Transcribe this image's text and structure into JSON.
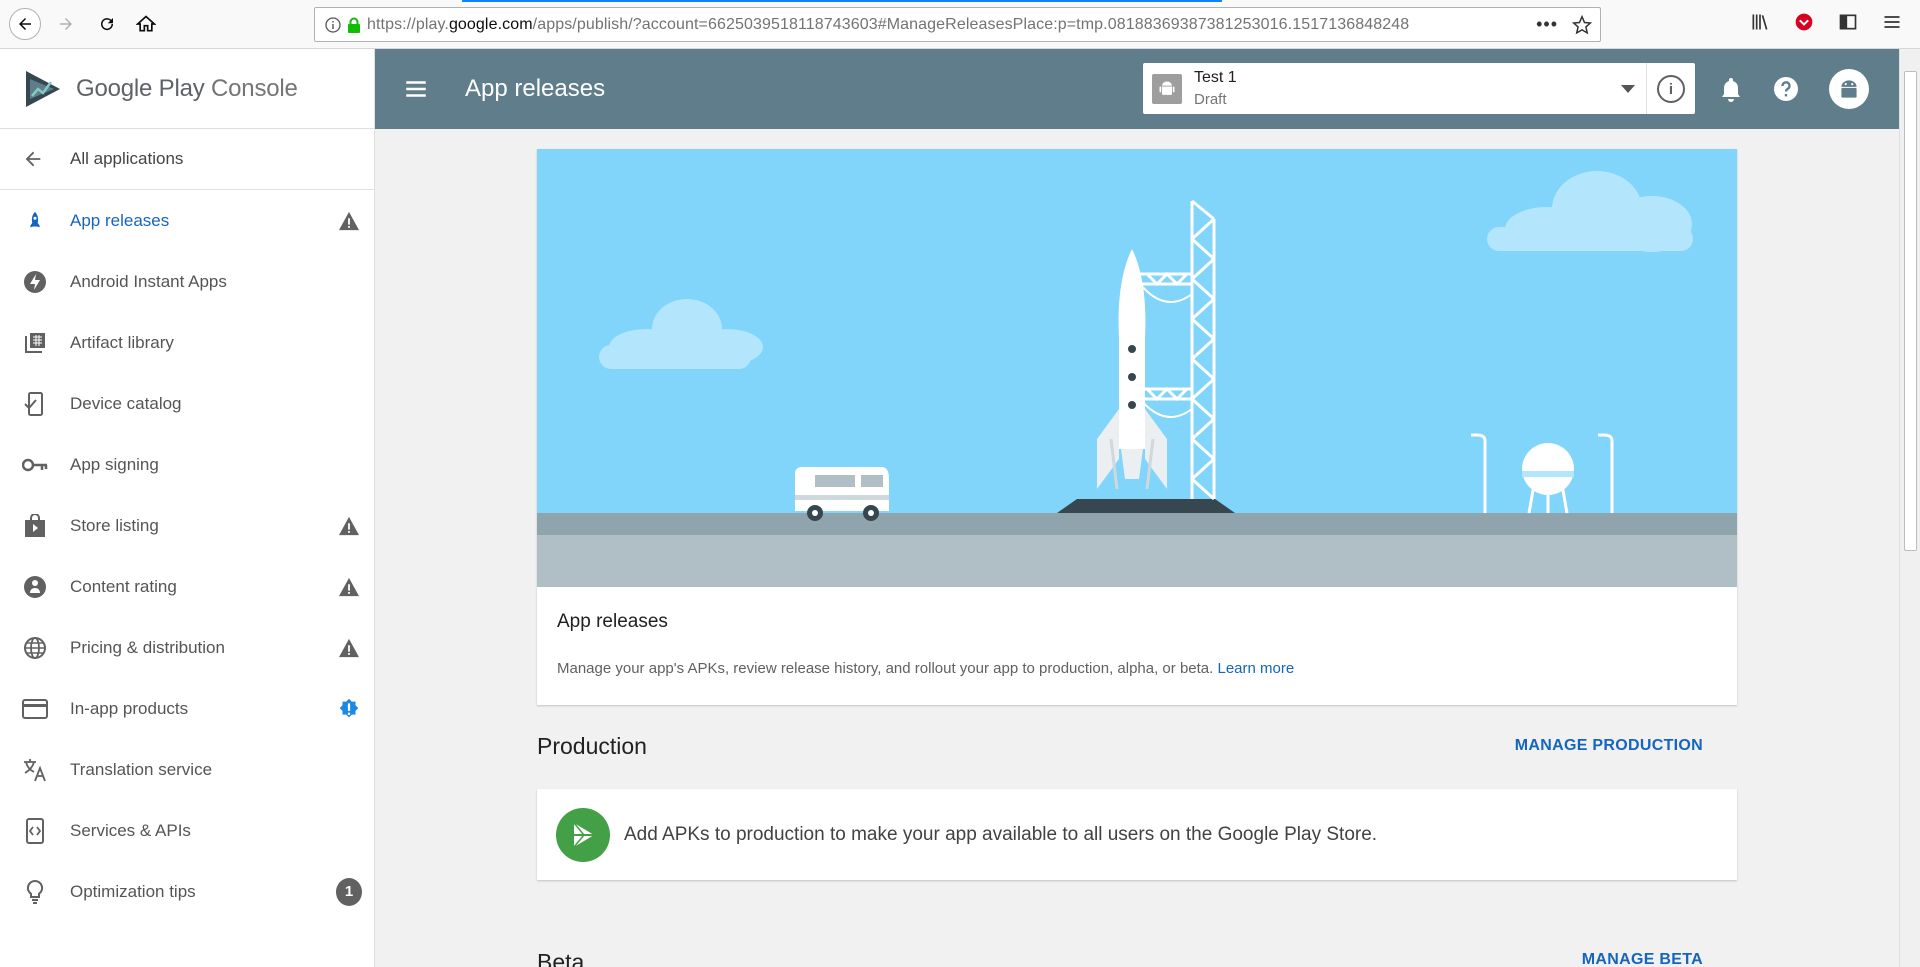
{
  "browser": {
    "url_prefix": "https://play.",
    "url_domain": "google.com",
    "url_rest": "/apps/publish/?account=6625039518118743603#ManageReleasesPlace:p=tmp.08188369387381253016.1517136848248"
  },
  "sidebar": {
    "brand_google_play": "Google Play",
    "brand_console": "Console",
    "back_label": "All applications",
    "items": [
      {
        "label": "App releases",
        "icon": "rocket-icon",
        "badge": "warning"
      },
      {
        "label": "Android Instant Apps",
        "icon": "bolt-icon",
        "badge": ""
      },
      {
        "label": "Artifact library",
        "icon": "library-icon",
        "badge": ""
      },
      {
        "label": "Device catalog",
        "icon": "device-icon",
        "badge": ""
      },
      {
        "label": "App signing",
        "icon": "key-icon",
        "badge": ""
      },
      {
        "label": "Store listing",
        "icon": "store-icon",
        "badge": "warning"
      },
      {
        "label": "Content rating",
        "icon": "rating-icon",
        "badge": "warning"
      },
      {
        "label": "Pricing & distribution",
        "icon": "globe-icon",
        "badge": "warning"
      },
      {
        "label": "In-app products",
        "icon": "card-icon",
        "badge": "info"
      },
      {
        "label": "Translation service",
        "icon": "translate-icon",
        "badge": ""
      },
      {
        "label": "Services & APIs",
        "icon": "api-icon",
        "badge": ""
      },
      {
        "label": "Optimization tips",
        "icon": "bulb-icon",
        "badge": "1"
      }
    ]
  },
  "header": {
    "title": "App releases",
    "app_name": "Test 1",
    "app_status": "Draft"
  },
  "main": {
    "card_title": "App releases",
    "card_desc": "Manage your app's APKs, review release history, and rollout your app to production, alpha, or beta.",
    "learn_more": "Learn more",
    "production_title": "Production",
    "manage_production": "MANAGE PRODUCTION",
    "production_msg": "Add APKs to production to make your app available to all users on the Google Play Store.",
    "beta_title": "Beta",
    "manage_beta": "MANAGE BETA"
  },
  "colors": {
    "header": "#607d8b",
    "accent": "#1565c0",
    "sky": "#81d4fa",
    "play_green": "#43a047"
  }
}
